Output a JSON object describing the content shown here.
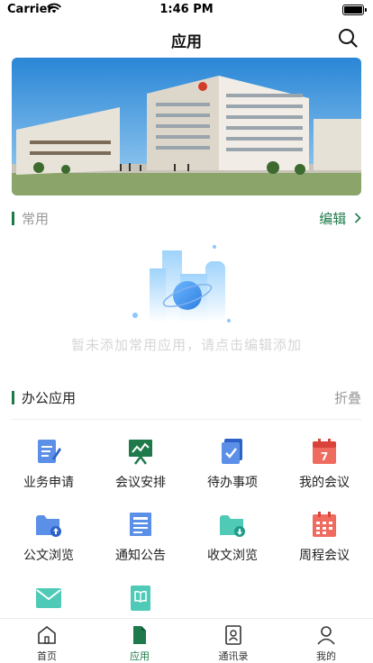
{
  "status_bar": {
    "carrier": "Carrier",
    "time": "1:46 PM"
  },
  "nav": {
    "title": "应用"
  },
  "common": {
    "title": "常用",
    "action": "编辑",
    "empty_text": "暂未添加常用应用，请点击编辑添加"
  },
  "office": {
    "title": "办公应用",
    "action": "折叠",
    "apps": [
      {
        "label": "业务申请",
        "icon": "apply-form-icon",
        "color": "#3d7be5"
      },
      {
        "label": "会议安排",
        "icon": "presentation-board-icon",
        "color": "#1e7a4a"
      },
      {
        "label": "待办事项",
        "icon": "todo-checklist-icon",
        "color": "#3d7be5"
      },
      {
        "label": "我的会议",
        "icon": "calendar-7-icon",
        "color": "#e0473f"
      },
      {
        "label": "公文浏览",
        "icon": "folder-upload-icon",
        "color": "#3d7be5"
      },
      {
        "label": "通知公告",
        "icon": "notice-document-icon",
        "color": "#3d7be5"
      },
      {
        "label": "收文浏览",
        "icon": "folder-download-icon",
        "color": "#2fb3a0"
      },
      {
        "label": "周程会议",
        "icon": "calendar-grid-icon",
        "color": "#e0473f"
      },
      {
        "label": "",
        "icon": "mail-icon",
        "color": "#2fb3a0"
      },
      {
        "label": "",
        "icon": "book-icon",
        "color": "#2fb3a0"
      }
    ]
  },
  "tabs": [
    {
      "label": "首页",
      "icon": "home-icon"
    },
    {
      "label": "应用",
      "icon": "document-icon",
      "active": true
    },
    {
      "label": "通讯录",
      "icon": "contacts-book-icon"
    },
    {
      "label": "我的",
      "icon": "person-icon"
    }
  ],
  "colors": {
    "accent": "#1e7a4a",
    "muted": "#999999",
    "empty_text": "#d6d6d6"
  }
}
